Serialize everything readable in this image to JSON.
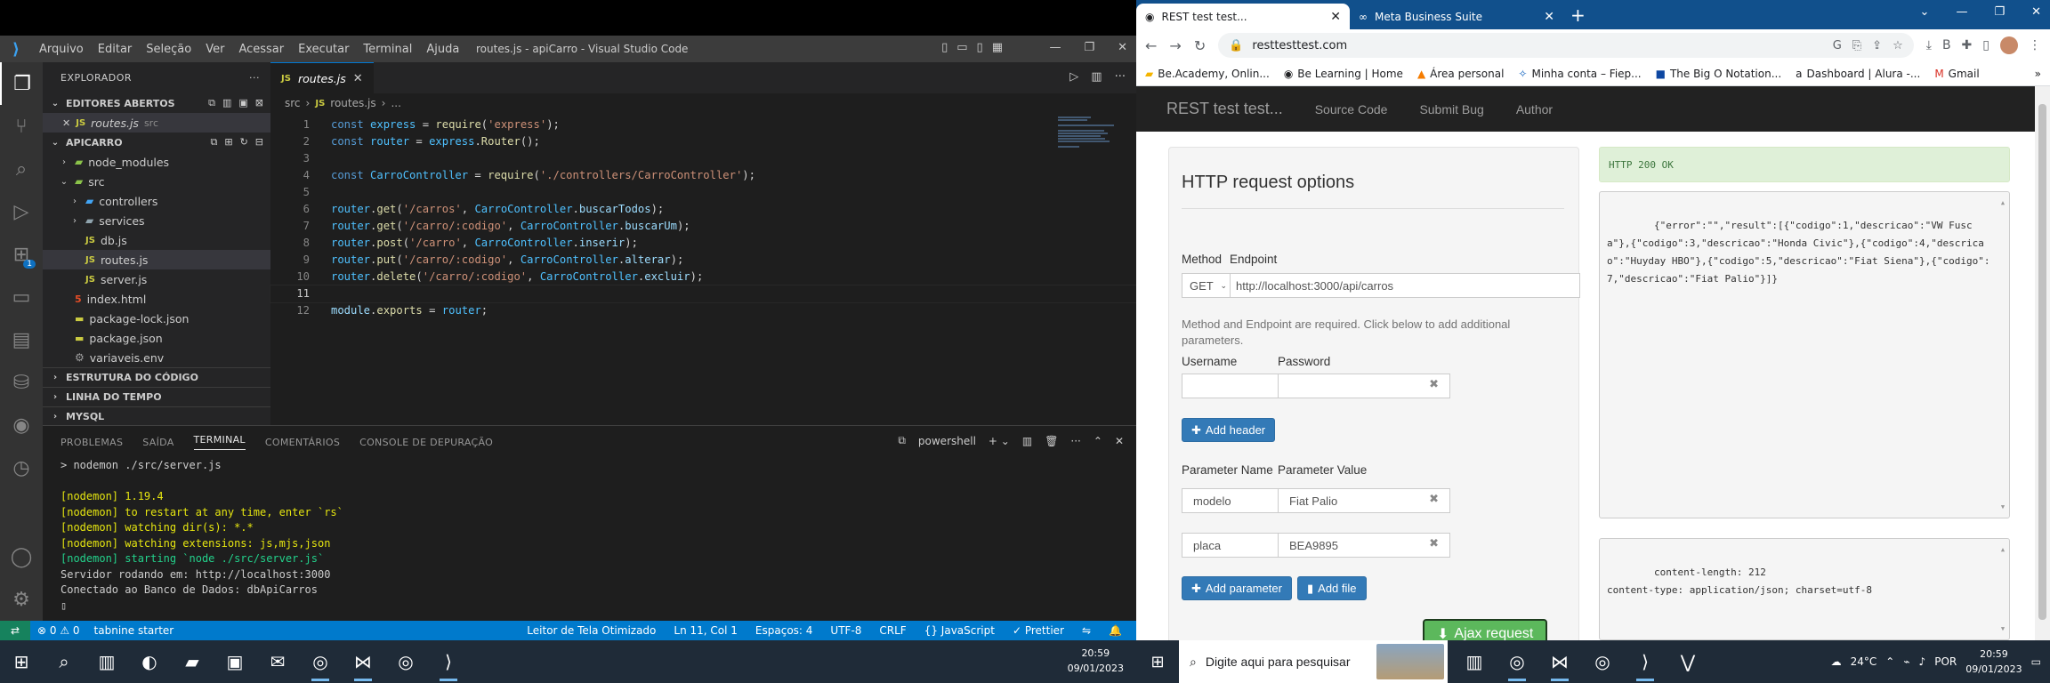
{
  "vscode": {
    "menu": [
      "Arquivo",
      "Editar",
      "Seleção",
      "Ver",
      "Acessar",
      "Executar",
      "Terminal",
      "Ajuda"
    ],
    "window_title": "routes.js - apiCarro - Visual Studio Code",
    "explorer_title": "EXPLORADOR",
    "open_editors_title": "EDITORES ABERTOS",
    "open_editor": {
      "name": "routes.js",
      "path": "src"
    },
    "project_title": "APICARRO",
    "tree": [
      {
        "name": "node_modules",
        "type": "folder",
        "depth": 1,
        "expanded": false
      },
      {
        "name": "src",
        "type": "folder",
        "depth": 1,
        "expanded": true
      },
      {
        "name": "controllers",
        "type": "folder",
        "depth": 2,
        "expanded": false
      },
      {
        "name": "services",
        "type": "folder",
        "depth": 2,
        "expanded": false
      },
      {
        "name": "db.js",
        "type": "js",
        "depth": 2
      },
      {
        "name": "routes.js",
        "type": "js",
        "depth": 2,
        "selected": true
      },
      {
        "name": "server.js",
        "type": "js",
        "depth": 2
      },
      {
        "name": "index.html",
        "type": "html",
        "depth": 1
      },
      {
        "name": "package-lock.json",
        "type": "json",
        "depth": 1
      },
      {
        "name": "package.json",
        "type": "json",
        "depth": 1
      },
      {
        "name": "variaveis.env",
        "type": "env",
        "depth": 1
      }
    ],
    "outline_title": "ESTRUTURA DO CÓDIGO",
    "timeline_title": "LINHA DO TEMPO",
    "mysql_title": "MYSQL",
    "active_tab": "routes.js",
    "breadcrumb": [
      "src",
      "routes.js",
      "..."
    ],
    "code": [
      "const express = require('express');",
      "const router = express.Router();",
      "",
      "const CarroController = require('./controllers/CarroController');",
      "",
      "router.get('/carros', CarroController.buscarTodos);",
      "router.get('/carro/:codigo', CarroController.buscarUm);",
      "router.post('/carro', CarroController.inserir);",
      "router.put('/carro/:codigo', CarroController.alterar);",
      "router.delete('/carro/:codigo', CarroController.excluir);",
      "",
      "module.exports = router;"
    ],
    "current_line": 11,
    "panel_tabs": [
      "PROBLEMAS",
      "SAÍDA",
      "TERMINAL",
      "COMENTÁRIOS",
      "CONSOLE DE DEPURAÇÃO"
    ],
    "active_panel_tab": "TERMINAL",
    "shell_name": "powershell",
    "terminal_lines": [
      {
        "text": "> nodemon ./src/server.js",
        "color": "plain"
      },
      {
        "text": "",
        "color": "plain"
      },
      {
        "text": "[nodemon] 1.19.4",
        "color": "yellow"
      },
      {
        "text": "[nodemon] to restart at any time, enter `rs`",
        "color": "yellow"
      },
      {
        "text": "[nodemon] watching dir(s): *.*",
        "color": "yellow"
      },
      {
        "text": "[nodemon] watching extensions: js,mjs,json",
        "color": "yellow"
      },
      {
        "text": "[nodemon] starting `node ./src/server.js`",
        "color": "green"
      },
      {
        "text": "Servidor rodando em: http://localhost:3000",
        "color": "plain"
      },
      {
        "text": "Conectado ao Banco de Dados: dbApiCarros",
        "color": "plain"
      },
      {
        "text": "▯",
        "color": "plain"
      }
    ],
    "status": {
      "problems": "⊗ 0 ⚠ 0",
      "tabnine": "tabnine starter",
      "screen_reader": "Leitor de Tela Otimizado",
      "position": "Ln 11, Col 1",
      "spaces": "Espaços: 4",
      "encoding": "UTF-8",
      "eol": "CRLF",
      "language": "{} JavaScript",
      "prettier": "✓ Prettier"
    },
    "explorer_badge": "1"
  },
  "chrome": {
    "tabs": [
      {
        "title": "REST test test...",
        "active": true
      },
      {
        "title": "Meta Business Suite",
        "active": false
      }
    ],
    "url": "resttesttest.com",
    "bookmarks": [
      "Be.Academy, Onlin...",
      "Be Learning | Home",
      "Área personal",
      "Minha conta – Fiep...",
      "The Big O Notation...",
      "Dashboard | Alura -...",
      "Gmail"
    ],
    "site": {
      "brand": "REST test test...",
      "nav": [
        "Source Code",
        "Submit Bug",
        "Author"
      ],
      "form_title": "HTTP request options",
      "method_label": "Method",
      "method_value": "GET",
      "endpoint_label": "Endpoint",
      "endpoint_value": "http://localhost:3000/api/carros",
      "help_text": "Method and Endpoint are required. Click below to add additional parameters.",
      "username_label": "Username",
      "password_label": "Password",
      "add_header": "Add header",
      "param_name_label": "Parameter Name",
      "param_value_label": "Parameter Value",
      "params": [
        {
          "name": "modelo",
          "value": "Fiat Palio"
        },
        {
          "name": "placa",
          "value": "BEA9895"
        }
      ],
      "add_parameter": "Add parameter",
      "add_file": "Add file",
      "ajax_button": "Ajax request",
      "response_status": "HTTP 200 OK",
      "response_body": "{\"error\":\"\",\"result\":[{\"codigo\":1,\"descricao\":\"VW Fusca\"},{\"codigo\":3,\"descricao\":\"Honda Civic\"},{\"codigo\":4,\"descricao\":\"Huyday HBO\"},{\"codigo\":5,\"descricao\":\"Fiat Siena\"},{\"codigo\":7,\"descricao\":\"Fiat Palio\"}]}",
      "response_headers": "content-length: 212\ncontent-type: application/json; charset=utf-8"
    }
  },
  "taskbar": {
    "search_placeholder": "Digite aqui para pesquisar",
    "weather": "24°C",
    "language": "POR",
    "time": "20:59",
    "date": "09/01/2023"
  },
  "colors": {
    "vs_accent": "#007acc",
    "chrome_tabstrip": "#11508c",
    "bootstrap_primary": "#337ab7",
    "bootstrap_success": "#5cb85c"
  }
}
